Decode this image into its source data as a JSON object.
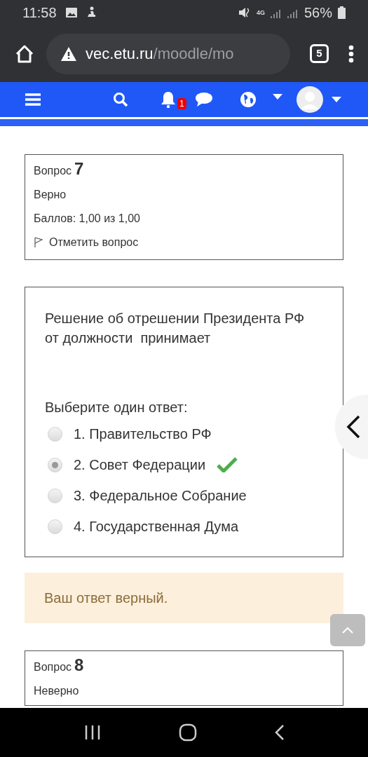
{
  "status_bar": {
    "time": "11:58",
    "network": "4G",
    "battery": "56%"
  },
  "browser": {
    "url_host": "vec.etu.ru",
    "url_path": "/moodle/mo",
    "tab_count": "5"
  },
  "navbar": {
    "notification_count": "1"
  },
  "questions": [
    {
      "label": "Вопрос",
      "number": "7",
      "state": "Верно",
      "grade": "Баллов: 1,00 из 1,00",
      "flag": "Отметить вопрос",
      "flagged": false
    },
    {
      "label": "Вопрос",
      "number": "8",
      "state": "Неверно"
    }
  ],
  "question_text": "Решение об отрешении Президента РФ от должности  принимает",
  "prompt": "Выберите один ответ:",
  "answers": [
    {
      "text": "1. Правительство РФ",
      "selected": false,
      "correct": false
    },
    {
      "text": "2. Совет Федерации",
      "selected": true,
      "correct": true
    },
    {
      "text": "3. Федеральное Собрание",
      "selected": false,
      "correct": false
    },
    {
      "text": "4. Государственная Дума",
      "selected": false,
      "correct": false
    }
  ],
  "feedback": "Ваш ответ верный."
}
